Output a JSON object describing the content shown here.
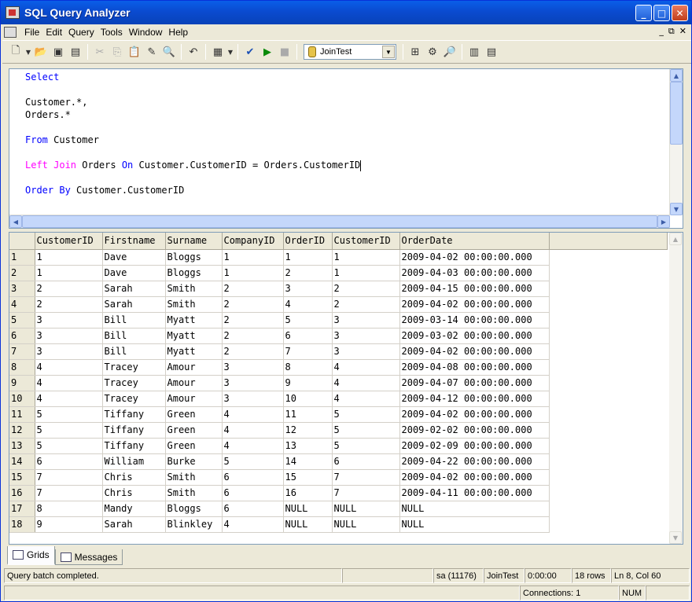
{
  "window": {
    "title": "SQL Query Analyzer"
  },
  "menu": [
    "File",
    "Edit",
    "Query",
    "Tools",
    "Window",
    "Help"
  ],
  "toolbar": {
    "database": "JoinTest"
  },
  "editor": {
    "lines": [
      [
        {
          "t": "Select",
          "c": "kw"
        }
      ],
      [],
      [
        {
          "t": "Customer.*,",
          "c": ""
        }
      ],
      [
        {
          "t": "Orders.*",
          "c": ""
        }
      ],
      [],
      [
        {
          "t": "From",
          "c": "kw"
        },
        {
          "t": " Customer",
          "c": ""
        }
      ],
      [],
      [
        {
          "t": "Left",
          "c": "kw2"
        },
        {
          "t": " Join",
          "c": "kw2"
        },
        {
          "t": " Orders ",
          "c": ""
        },
        {
          "t": "On",
          "c": "kw"
        },
        {
          "t": " Customer.CustomerID = Orders.CustomerID",
          "c": ""
        }
      ],
      [],
      [
        {
          "t": "Order By",
          "c": "kw"
        },
        {
          "t": " Customer.CustomerID",
          "c": ""
        }
      ]
    ]
  },
  "grid": {
    "columns": [
      "CustomerID",
      "Firstname",
      "Surname",
      "CompanyID",
      "OrderID",
      "CustomerID",
      "OrderDate"
    ],
    "rows": [
      [
        "1",
        "1",
        "Dave",
        "Bloggs",
        "1",
        "1",
        "1",
        "2009-04-02 00:00:00.000"
      ],
      [
        "2",
        "1",
        "Dave",
        "Bloggs",
        "1",
        "2",
        "1",
        "2009-04-03 00:00:00.000"
      ],
      [
        "3",
        "2",
        "Sarah",
        "Smith",
        "2",
        "3",
        "2",
        "2009-04-15 00:00:00.000"
      ],
      [
        "4",
        "2",
        "Sarah",
        "Smith",
        "2",
        "4",
        "2",
        "2009-04-02 00:00:00.000"
      ],
      [
        "5",
        "3",
        "Bill",
        "Myatt",
        "2",
        "5",
        "3",
        "2009-03-14 00:00:00.000"
      ],
      [
        "6",
        "3",
        "Bill",
        "Myatt",
        "2",
        "6",
        "3",
        "2009-03-02 00:00:00.000"
      ],
      [
        "7",
        "3",
        "Bill",
        "Myatt",
        "2",
        "7",
        "3",
        "2009-04-02 00:00:00.000"
      ],
      [
        "8",
        "4",
        "Tracey",
        "Amour",
        "3",
        "8",
        "4",
        "2009-04-08 00:00:00.000"
      ],
      [
        "9",
        "4",
        "Tracey",
        "Amour",
        "3",
        "9",
        "4",
        "2009-04-07 00:00:00.000"
      ],
      [
        "10",
        "4",
        "Tracey",
        "Amour",
        "3",
        "10",
        "4",
        "2009-04-12 00:00:00.000"
      ],
      [
        "11",
        "5",
        "Tiffany",
        "Green",
        "4",
        "11",
        "5",
        "2009-04-02 00:00:00.000"
      ],
      [
        "12",
        "5",
        "Tiffany",
        "Green",
        "4",
        "12",
        "5",
        "2009-02-02 00:00:00.000"
      ],
      [
        "13",
        "5",
        "Tiffany",
        "Green",
        "4",
        "13",
        "5",
        "2009-02-09 00:00:00.000"
      ],
      [
        "14",
        "6",
        "William",
        "Burke",
        "5",
        "14",
        "6",
        "2009-04-22 00:00:00.000"
      ],
      [
        "15",
        "7",
        "Chris",
        "Smith",
        "6",
        "15",
        "7",
        "2009-04-02 00:00:00.000"
      ],
      [
        "16",
        "7",
        "Chris",
        "Smith",
        "6",
        "16",
        "7",
        "2009-04-11 00:00:00.000"
      ],
      [
        "17",
        "8",
        "Mandy",
        "Bloggs",
        "6",
        "NULL",
        "NULL",
        "NULL"
      ],
      [
        "18",
        "9",
        "Sarah",
        "Blinkley",
        "4",
        "NULL",
        "NULL",
        "NULL"
      ]
    ]
  },
  "tabs": {
    "grids": "Grids",
    "messages": "Messages"
  },
  "status": {
    "message": "Query batch completed.",
    "user": "sa (11176)",
    "db": "JoinTest",
    "time": "0:00:00",
    "rows": "18 rows",
    "position": "Ln 8, Col 60",
    "connections": "Connections: 1",
    "num": "NUM"
  }
}
